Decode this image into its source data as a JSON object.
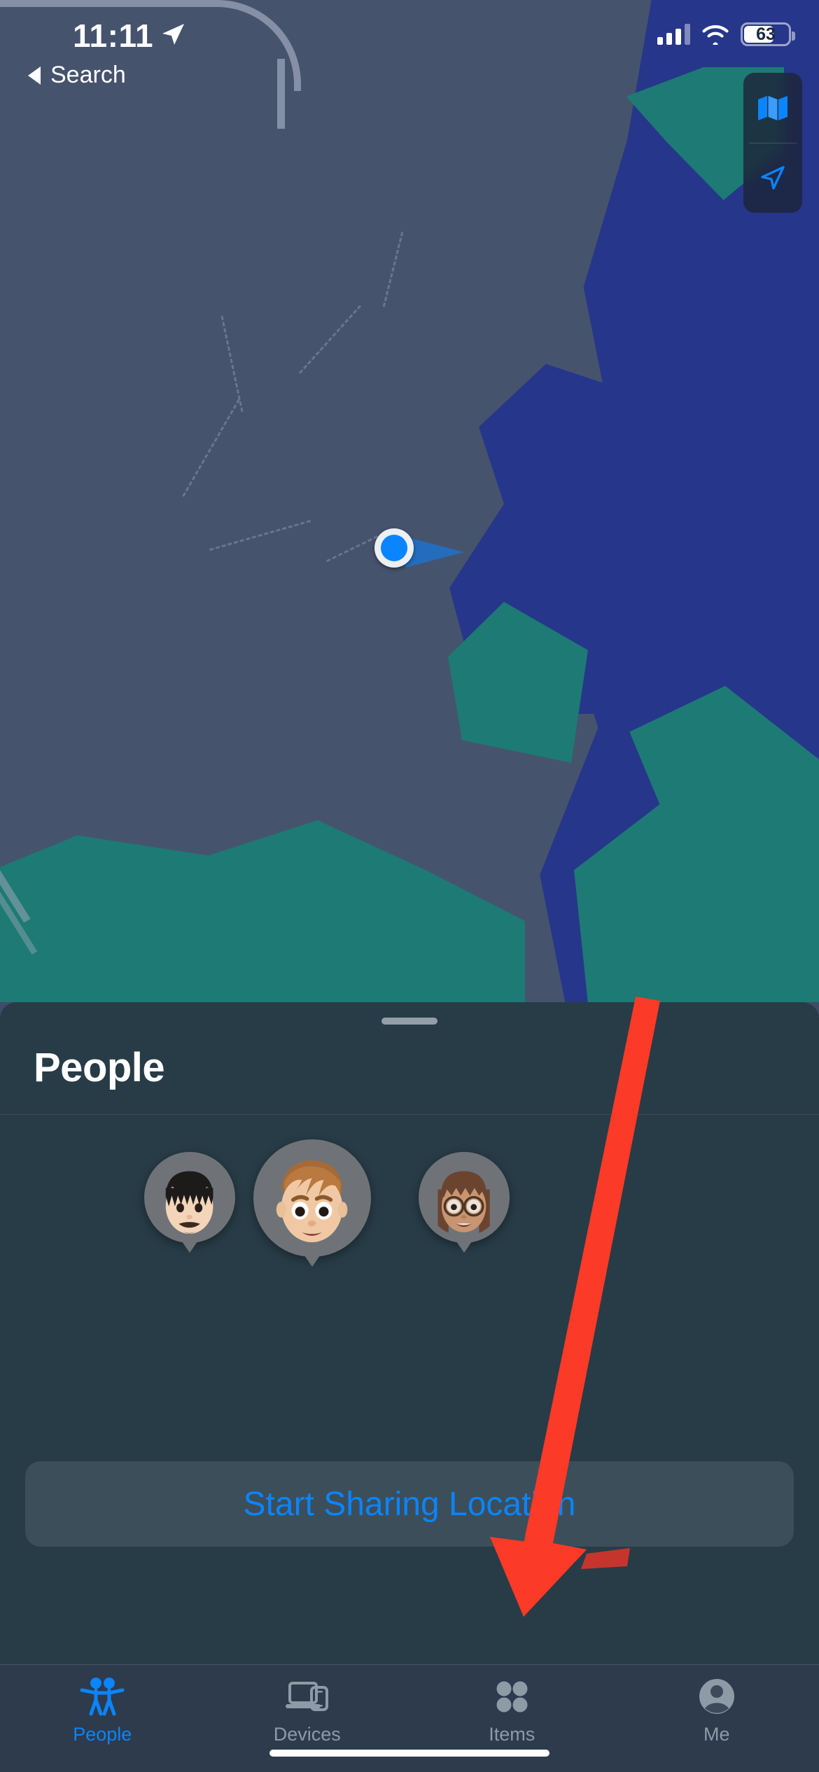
{
  "status_bar": {
    "time": "11:11",
    "location_arrow_icon": "location-arrow-icon",
    "cellular_icon": "cellular-bars-icon",
    "cellular_bars_filled": 3,
    "cellular_bars_total": 4,
    "wifi_icon": "wifi-icon",
    "battery_percent": "63",
    "battery_level": 63,
    "battery_icon": "battery-icon"
  },
  "navigation": {
    "back_label": "Search",
    "back_icon": "back-chevron-icon"
  },
  "map": {
    "style_button_icon": "map-folded-icon",
    "locate_button_icon": "navigation-arrow-icon",
    "user_location_icon": "user-location-dot",
    "colors": {
      "land": "#46536d",
      "water": "#26368a",
      "park": "#1d7a74",
      "road": "#9aa4b8",
      "user_dot": "#0a84ff"
    }
  },
  "sheet": {
    "title": "People",
    "grabber": "sheet-grabber",
    "people": [
      {
        "avatar": "memoji-dark-hair-mustache",
        "hair": "#1d1b1a",
        "skin": "#f2d2b6"
      },
      {
        "avatar": "memoji-auburn-hair",
        "hair": "#a56a36",
        "skin": "#f0c9a4"
      },
      {
        "avatar": "memoji-glasses-long-hair",
        "hair": "#6b4430",
        "skin": "#c89570"
      }
    ],
    "share_button_label": "Start Sharing Location"
  },
  "tab_bar": {
    "tabs": [
      {
        "label": "People",
        "icon": "two-people-icon",
        "active": true
      },
      {
        "label": "Devices",
        "icon": "laptop-phone-icon",
        "active": false
      },
      {
        "label": "Items",
        "icon": "four-dots-grid-icon",
        "active": false
      },
      {
        "label": "Me",
        "icon": "person-circle-icon",
        "active": false
      }
    ],
    "active_color": "#0a84ff",
    "inactive_color": "#8e9aa6"
  },
  "annotation": {
    "type": "arrow",
    "color": "#fb3a27",
    "points_to": "Items",
    "description": "red arrow pointing at the Items tab"
  }
}
